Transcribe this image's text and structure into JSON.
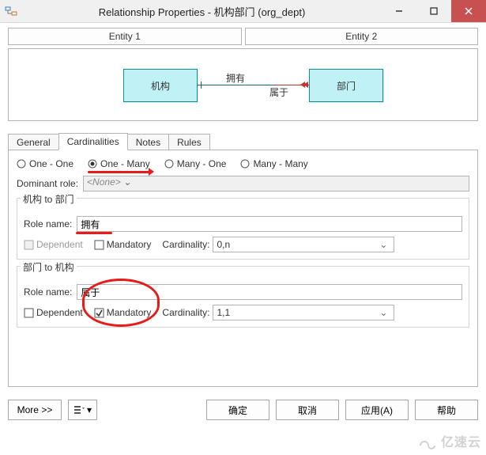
{
  "window": {
    "title": "Relationship Properties - 机构部门 (org_dept)"
  },
  "entities": {
    "col1": "Entity 1",
    "col2": "Entity 2"
  },
  "diagram": {
    "left_entity": "机构",
    "right_entity": "部门",
    "top_label": "拥有",
    "bottom_label": "属于"
  },
  "tabs": [
    "General",
    "Cardinalities",
    "Notes",
    "Rules"
  ],
  "active_tab": "Cardinalities",
  "card_panel": {
    "radios": {
      "one_one": "One - One",
      "one_many": "One - Many",
      "many_one": "Many - One",
      "many_many": "Many - Many",
      "selected": "one_many"
    },
    "dominant_label": "Dominant role:",
    "dominant_value": "<None>",
    "group1": {
      "legend": "机构 to 部门",
      "role_label": "Role name:",
      "role_value": "拥有",
      "dependent": {
        "label": "Dependent",
        "checked": false,
        "enabled": false
      },
      "mandatory": {
        "label": "Mandatory",
        "checked": false,
        "enabled": true
      },
      "cardinality_label": "Cardinality:",
      "cardinality_value": "0,n"
    },
    "group2": {
      "legend": "部门 to 机构",
      "role_label": "Role name:",
      "role_value": "属于",
      "dependent": {
        "label": "Dependent",
        "checked": false,
        "enabled": true
      },
      "mandatory": {
        "label": "Mandatory",
        "checked": true,
        "enabled": true
      },
      "cardinality_label": "Cardinality:",
      "cardinality_value": "1,1"
    }
  },
  "buttons": {
    "more": "More >>",
    "ok": "确定",
    "cancel": "取消",
    "apply": "应用(A)",
    "help": "帮助"
  },
  "watermark": "亿速云"
}
